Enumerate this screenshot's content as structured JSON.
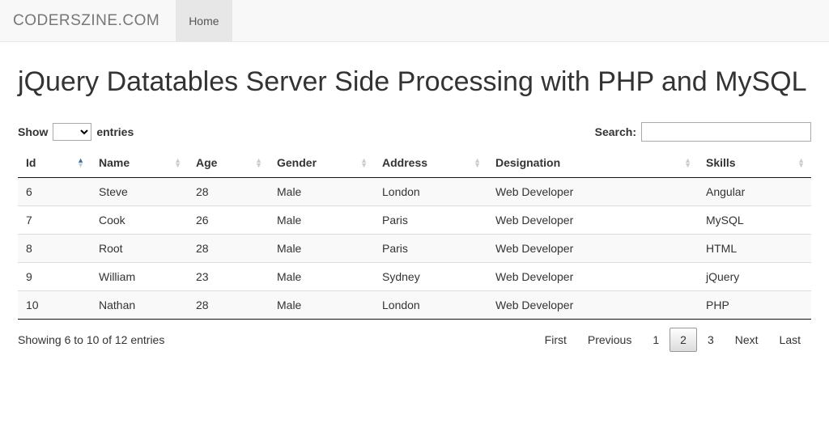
{
  "navbar": {
    "brand": "CODERSZINE.COM",
    "home": "Home"
  },
  "page": {
    "title": "jQuery Datatables Server Side Processing with PHP and MySQL"
  },
  "controls": {
    "show_label_pre": "Show",
    "show_label_post": "entries",
    "search_label": "Search:"
  },
  "table": {
    "headers": {
      "id": "Id",
      "name": "Name",
      "age": "Age",
      "gender": "Gender",
      "address": "Address",
      "designation": "Designation",
      "skills": "Skills"
    },
    "rows": [
      {
        "id": "6",
        "name": "Steve",
        "age": "28",
        "gender": "Male",
        "address": "London",
        "designation": "Web Developer",
        "skills": "Angular"
      },
      {
        "id": "7",
        "name": "Cook",
        "age": "26",
        "gender": "Male",
        "address": "Paris",
        "designation": "Web Developer",
        "skills": "MySQL"
      },
      {
        "id": "8",
        "name": "Root",
        "age": "28",
        "gender": "Male",
        "address": "Paris",
        "designation": "Web Developer",
        "skills": "HTML"
      },
      {
        "id": "9",
        "name": "William",
        "age": "23",
        "gender": "Male",
        "address": "Sydney",
        "designation": "Web Developer",
        "skills": "jQuery"
      },
      {
        "id": "10",
        "name": "Nathan",
        "age": "28",
        "gender": "Male",
        "address": "London",
        "designation": "Web Developer",
        "skills": "PHP"
      }
    ]
  },
  "footer": {
    "info": "Showing 6 to 10 of 12 entries",
    "pagination": {
      "first": "First",
      "previous": "Previous",
      "p1": "1",
      "p2": "2",
      "p3": "3",
      "next": "Next",
      "last": "Last"
    }
  }
}
